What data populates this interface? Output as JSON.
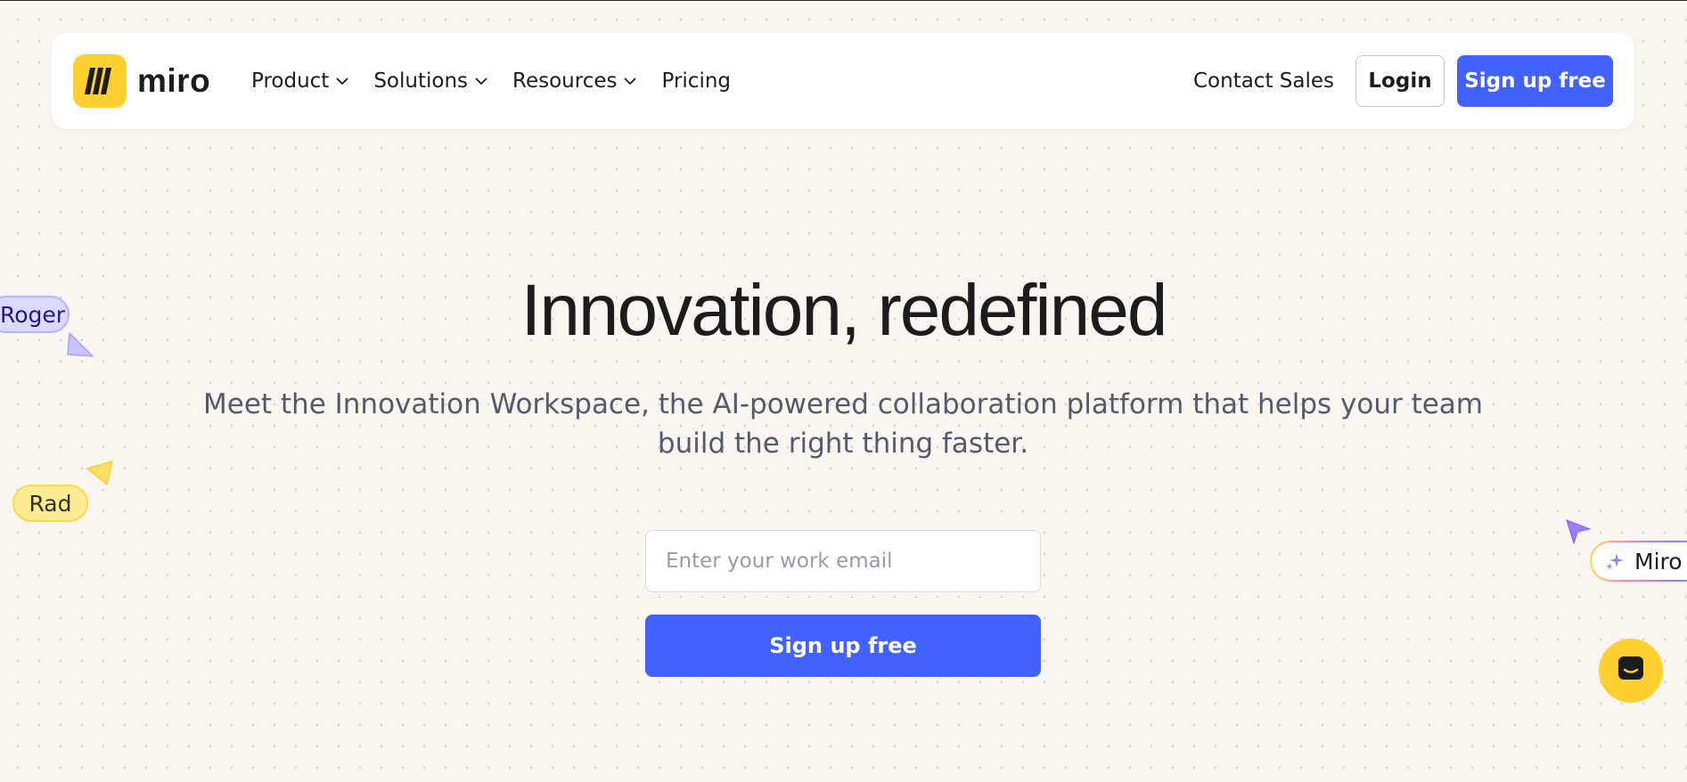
{
  "header": {
    "logo_text": "miro",
    "nav": [
      {
        "label": "Product",
        "has_dropdown": true
      },
      {
        "label": "Solutions",
        "has_dropdown": true
      },
      {
        "label": "Resources",
        "has_dropdown": true
      },
      {
        "label": "Pricing",
        "has_dropdown": false
      }
    ],
    "contact_label": "Contact Sales",
    "login_label": "Login",
    "signup_label": "Sign up free"
  },
  "hero": {
    "title": "Innovation, redefined",
    "subtitle": "Meet the Innovation Workspace, the AI-powered collaboration platform that helps your team build the right thing faster.",
    "email_placeholder": "Enter your work email",
    "signup_label": "Sign up free"
  },
  "cursors": {
    "roger": "Roger",
    "rad": "Rad",
    "miro_ai": "Miro"
  },
  "colors": {
    "brand_yellow": "#ffd02f",
    "primary_blue": "#4262ff",
    "background": "#f9f6f1"
  },
  "icons": {
    "logo": "miro-logo-icon",
    "dropdown": "chevron-down-icon",
    "sparkle": "sparkle-icon",
    "chat": "chat-icon"
  }
}
